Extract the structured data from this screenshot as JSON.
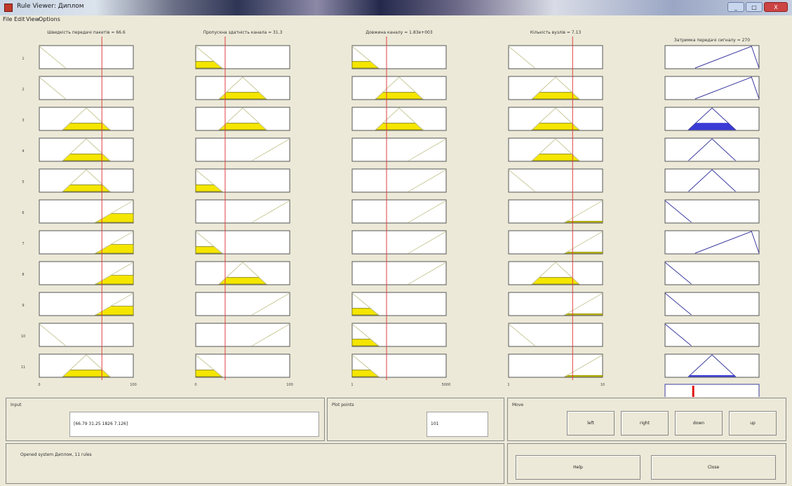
{
  "window": {
    "title": "Rule Viewer: Диплом",
    "min_label": "_",
    "max_label": "□",
    "close_label": "X"
  },
  "menu": [
    "File",
    "Edit",
    "View",
    "Options"
  ],
  "chart_data": {
    "type": "rule-viewer",
    "inputs": [
      {
        "name": "Швидкість передачі пакетів",
        "value_text": "Швидкість передачі пакетів = 66.6",
        "range": [
          0,
          100
        ],
        "tick_labels": [
          "0",
          "100"
        ],
        "value": 66.6
      },
      {
        "name": "Пропускна здатність канала",
        "value_text": "Пропускна здатність канала = 31.3",
        "range": [
          0,
          100
        ],
        "tick_labels": [
          "0",
          "100"
        ],
        "value": 31.3
      },
      {
        "name": "Довжина каналу",
        "value_text": "Довжина каналу = 1.83e+003",
        "range": [
          1,
          5000
        ],
        "tick_labels": [
          "1",
          "5000"
        ],
        "value": 1830
      },
      {
        "name": "Кількість вузлів",
        "value_text": "Кількість вузлів = 7.13",
        "range": [
          1,
          10
        ],
        "tick_labels": [
          "1",
          "10"
        ],
        "value": 7.13
      }
    ],
    "output": {
      "name": "Затримка передачі сигналу",
      "value_text": "Затримка передачі сигналу = 270",
      "value": 270
    },
    "rule_numbers": [
      "1",
      "2",
      "3",
      "4",
      "5",
      "6",
      "7",
      "8",
      "9",
      "10",
      "11"
    ],
    "rules": [
      {
        "mfs": [
          "low",
          "low",
          "low",
          "low",
          "rh"
        ],
        "fired": [
          0,
          0.3,
          0.3,
          0,
          0
        ]
      },
      {
        "mfs": [
          "low",
          "mid",
          "mid",
          "mid",
          "rh"
        ],
        "fired": [
          0,
          0.3,
          0.3,
          0.3,
          0
        ]
      },
      {
        "mfs": [
          "mid",
          "mid",
          "mid",
          "mid",
          "mid"
        ],
        "fired": [
          0.3,
          0.3,
          0.3,
          0.3,
          0.3
        ]
      },
      {
        "mfs": [
          "mid",
          "high",
          "high",
          "mid",
          "mid"
        ],
        "fired": [
          0.3,
          0,
          0,
          0.3,
          0
        ]
      },
      {
        "mfs": [
          "mid",
          "low",
          "high",
          "low",
          "mid"
        ],
        "fired": [
          0.3,
          0.3,
          0,
          0,
          0
        ]
      },
      {
        "mfs": [
          "high",
          "high",
          "high",
          "high",
          "low"
        ],
        "fired": [
          0.4,
          0,
          0,
          0.05,
          0
        ]
      },
      {
        "mfs": [
          "high",
          "low",
          "high",
          "high",
          "rh"
        ],
        "fired": [
          0.4,
          0.3,
          0,
          0.05,
          0
        ]
      },
      {
        "mfs": [
          "high",
          "mid",
          "high",
          "mid",
          "low"
        ],
        "fired": [
          0.4,
          0.3,
          0,
          0.3,
          0
        ]
      },
      {
        "mfs": [
          "high",
          "high",
          "low",
          "high",
          "low"
        ],
        "fired": [
          0.4,
          0,
          0.3,
          0.05,
          0
        ]
      },
      {
        "mfs": [
          "low",
          "high",
          "low",
          "low",
          "low"
        ],
        "fired": [
          0,
          0,
          0.3,
          0,
          0
        ]
      },
      {
        "mfs": [
          "mid",
          "low",
          "low",
          "high",
          "mid"
        ],
        "fired": [
          0.3,
          0.3,
          0.3,
          0.05,
          0.05
        ]
      }
    ],
    "colors": {
      "fill": "#f5e600",
      "fill_edge": "#808000",
      "output_fill": "#3a3ad6",
      "mf_line": "#c9c99a",
      "mf_line_out": "#3c3ca0",
      "value_line": "#e04040",
      "aggregate_line": "#e21010"
    }
  },
  "bottom": {
    "input_label": "Input",
    "input_value": "[66.79 31.25 1826 7.126]",
    "plot_points_label": "Plot points",
    "plot_points_value": "101",
    "move_label": "Move",
    "buttons": {
      "left": "left",
      "right": "right",
      "down": "down",
      "up": "up",
      "help": "Help",
      "close": "Close"
    },
    "status": "Opened system Диплом, 11 rules"
  }
}
